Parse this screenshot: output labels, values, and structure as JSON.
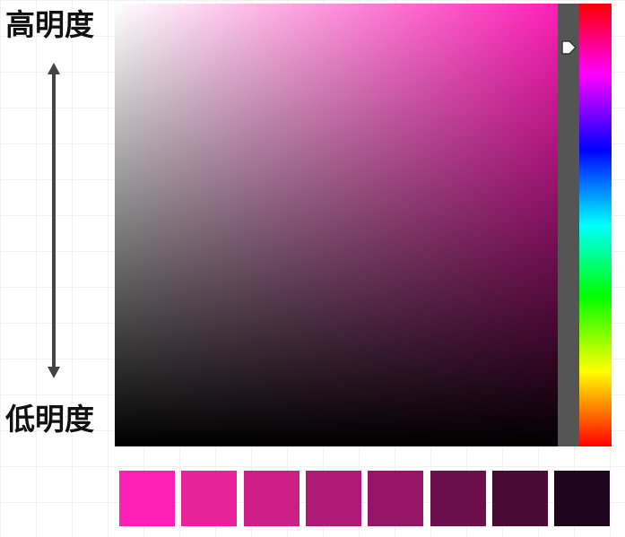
{
  "labels": {
    "high": "高明度",
    "low": "低明度"
  },
  "picker": {
    "hue_color": "#ff1fb7",
    "hue_position": 0.1,
    "track_color": "#555555"
  },
  "swatches": [
    "#ff1fb7",
    "#e8229a",
    "#cc1f86",
    "#b01a77",
    "#951466",
    "#6e0f4d",
    "#4a0a35",
    "#20061c"
  ]
}
